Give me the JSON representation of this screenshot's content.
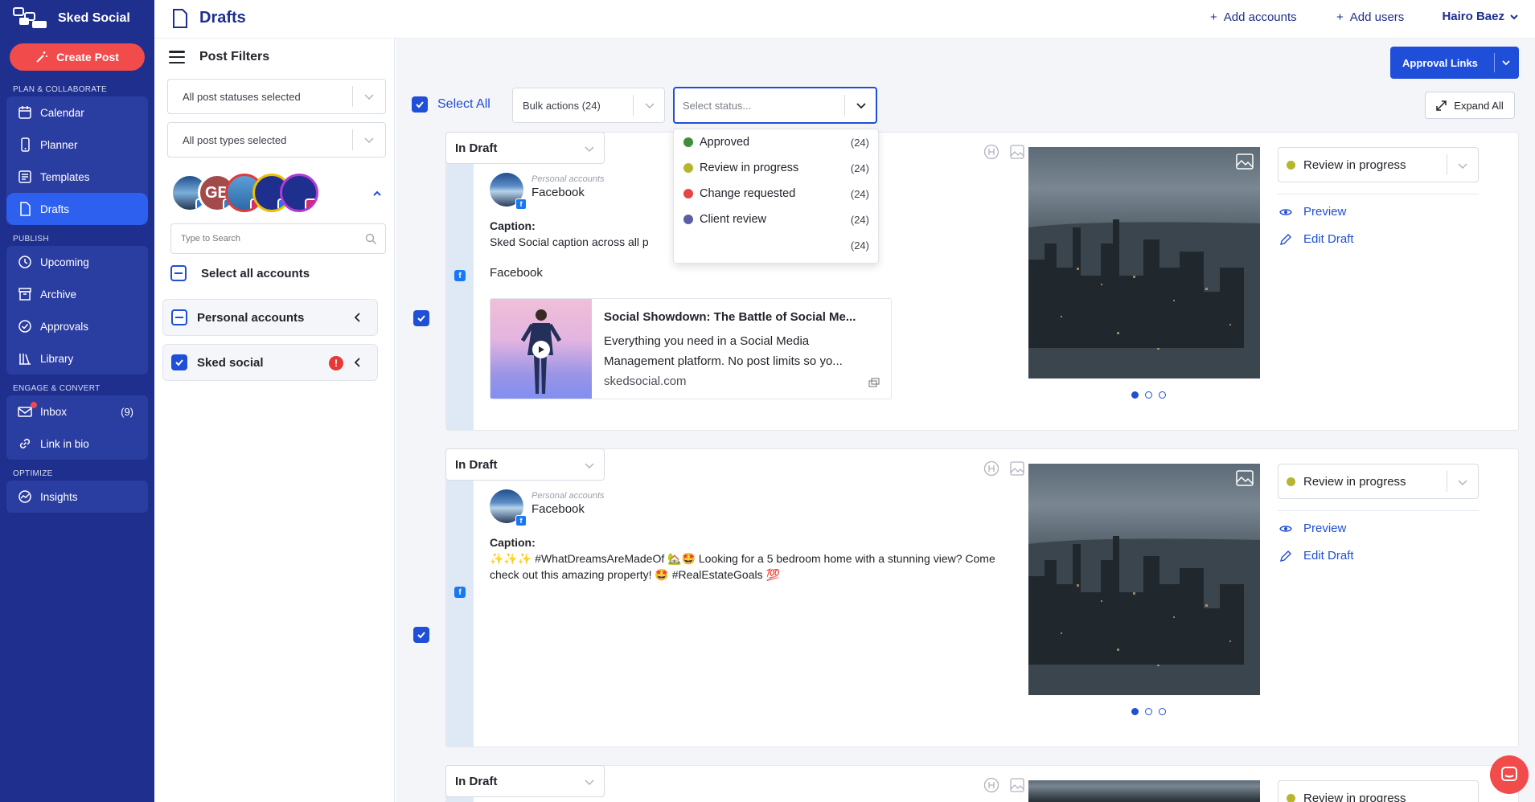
{
  "brand": {
    "name": "Sked Social"
  },
  "sidebar": {
    "create_label": "Create Post",
    "sections": [
      {
        "title": "Plan & Collaborate",
        "items": [
          {
            "label": "Calendar",
            "icon": "calendar-icon"
          },
          {
            "label": "Planner",
            "icon": "phone-icon"
          },
          {
            "label": "Templates",
            "icon": "templates-icon"
          },
          {
            "label": "Drafts",
            "icon": "document-icon",
            "active": true
          }
        ]
      },
      {
        "title": "Publish",
        "items": [
          {
            "label": "Upcoming",
            "icon": "clock-icon"
          },
          {
            "label": "Archive",
            "icon": "archive-icon"
          },
          {
            "label": "Approvals",
            "icon": "check-circle-icon"
          },
          {
            "label": "Library",
            "icon": "library-icon"
          }
        ]
      },
      {
        "title": "Engage & Convert",
        "items": [
          {
            "label": "Inbox",
            "icon": "mail-icon",
            "count": "(9)"
          },
          {
            "label": "Link in bio",
            "icon": "link-icon"
          }
        ]
      },
      {
        "title": "Optimize",
        "items": [
          {
            "label": "Insights",
            "icon": "insights-icon"
          }
        ]
      }
    ]
  },
  "topbar": {
    "title": "Drafts",
    "add_accounts": "Add accounts",
    "add_users": "Add users",
    "user": "Hairo Baez"
  },
  "filters": {
    "title": "Post Filters",
    "status_select": "All post statuses selected",
    "type_select": "All post types selected",
    "avatar_initials": "GB",
    "search_placeholder": "Type to Search",
    "select_all_accounts": "Select all accounts",
    "groups": [
      {
        "label": "Personal accounts"
      },
      {
        "label": "Sked social",
        "warning": "!"
      }
    ]
  },
  "toolbar": {
    "approval_links": "Approval Links",
    "expand_all": "Expand All",
    "select_all": "Select All",
    "bulk_actions": "Bulk actions (24)",
    "status_placeholder": "Select status...",
    "status_options": [
      {
        "label": "Approved",
        "count": "(24)",
        "color": "#3f8f3a"
      },
      {
        "label": "Review in progress",
        "count": "(24)",
        "color": "#b6b62e"
      },
      {
        "label": "Change requested",
        "count": "(24)",
        "color": "#e84545"
      },
      {
        "label": "Client review",
        "count": "(24)",
        "color": "#5b5ea6"
      },
      {
        "label": "",
        "count": "(24)",
        "color": ""
      }
    ]
  },
  "posts": [
    {
      "state": "In Draft",
      "account_group": "Personal accounts",
      "account": "Facebook",
      "caption_label": "Caption:",
      "caption": "Sked Social caption across all p",
      "platform": "Facebook",
      "link": {
        "title": "Social Showdown: The Battle of Social Me...",
        "desc": "Everything you need in a Social Media Management platform. No post limits so yo...",
        "url": "skedsocial.com"
      },
      "review": "Review in progress",
      "preview": "Preview",
      "edit": "Edit Draft"
    },
    {
      "state": "In Draft",
      "account_group": "Personal accounts",
      "account": "Facebook",
      "caption_label": "Caption:",
      "caption": "✨✨✨ #WhatDreamsAreMadeOf 🏡🤩 Looking for a 5 bedroom home with a stunning view? Come check out this amazing property! 🤩 #RealEstateGoals 💯",
      "review": "Review in progress",
      "preview": "Preview",
      "edit": "Edit Draft"
    },
    {
      "state": "In Draft",
      "review": "Review in progress"
    }
  ]
}
